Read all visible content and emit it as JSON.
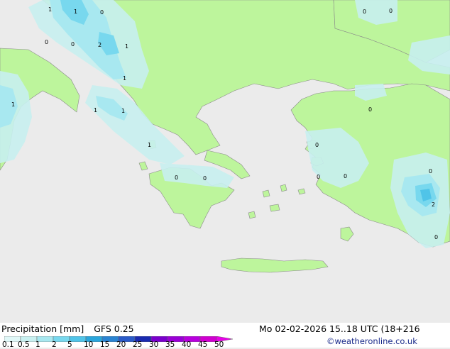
{
  "legend": {
    "title": "Precipitation [mm]",
    "model": "GFS 0.25",
    "ticks": [
      "0.1",
      "0.5",
      "1",
      "2",
      "5",
      "10",
      "15",
      "20",
      "25",
      "30",
      "35",
      "40",
      "45",
      "50"
    ],
    "colors": [
      "#e0f8f8",
      "#c8f0f0",
      "#a8e8f0",
      "#78d8ee",
      "#50c4e8",
      "#2aa6dc",
      "#2a84d2",
      "#2a5ac8",
      "#1a2ab0",
      "#7a00cc",
      "#9a00d6",
      "#b800de",
      "#d000d0",
      "#e800e8"
    ]
  },
  "valid_time": "Mo 02-02-2026 15..18 UTC (18+216",
  "credit": "©weatheronline.co.uk",
  "map_labels": [
    "1",
    "1",
    "0",
    "0",
    "0",
    "2",
    "1",
    "1",
    "1",
    "1",
    "1",
    "1",
    "0",
    "0",
    "0",
    "0",
    "0",
    "0",
    "0",
    "0",
    "2",
    "0",
    "0"
  ],
  "land_color": "#bdf59c",
  "sea_color": "#ebebeb"
}
